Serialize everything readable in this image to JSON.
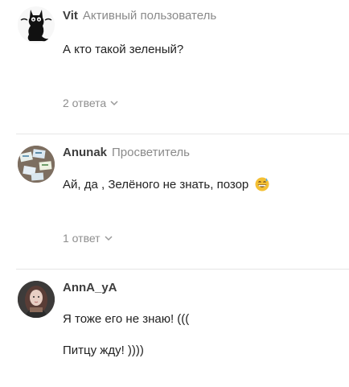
{
  "comments": [
    {
      "author": "Vit",
      "role": "Активный пользователь",
      "lines": [
        "А кто такой зеленый?"
      ],
      "avatar_icon": "black-cat-icon",
      "replies_label": "2 ответа"
    },
    {
      "author": "Anunak",
      "role": "Просветитель",
      "lines": [
        "Ай, да , Зелёного не знать, позор"
      ],
      "emoji": "grinning-sweat-emoji",
      "avatar_icon": "photo-avatar",
      "replies_label": "1 ответ"
    },
    {
      "author": "AnnA_yA",
      "role": "",
      "lines": [
        "Я тоже его не знаю! (((",
        "Питцу жду! ))))"
      ],
      "avatar_icon": "girl-photo-avatar"
    }
  ],
  "colors": {
    "author": "#3d3d3d",
    "role": "#8a8a8a",
    "replies": "#8e8e8e",
    "divider": "#e6e6e6"
  }
}
